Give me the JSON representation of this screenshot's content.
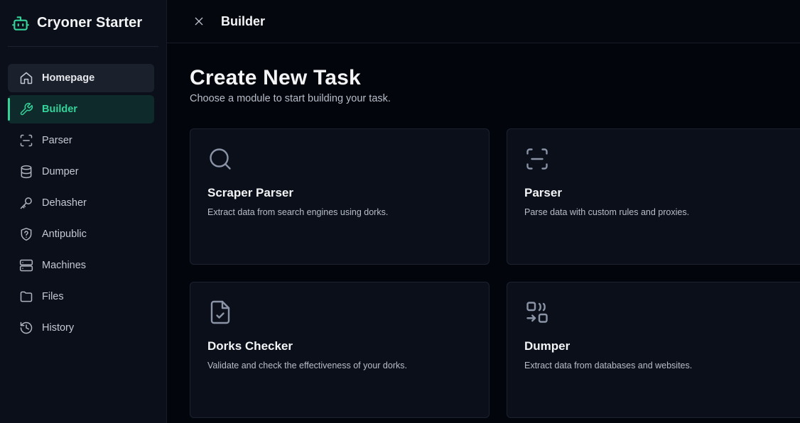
{
  "app": {
    "title": "Cryoner Starter",
    "logo_icon": "robot-icon",
    "accent": "#34d399"
  },
  "sidebar": {
    "items": [
      {
        "label": "Homepage",
        "icon": "home-icon"
      },
      {
        "label": "Builder",
        "icon": "wrench-icon",
        "active": true
      },
      {
        "label": "Parser",
        "icon": "scan-icon"
      },
      {
        "label": "Dumper",
        "icon": "database-icon"
      },
      {
        "label": "Dehasher",
        "icon": "key-icon"
      },
      {
        "label": "Antipublic",
        "icon": "shield-question-icon"
      },
      {
        "label": "Machines",
        "icon": "server-icon"
      },
      {
        "label": "Files",
        "icon": "folder-icon"
      },
      {
        "label": "History",
        "icon": "history-icon"
      }
    ]
  },
  "topbar": {
    "title": "Builder",
    "close_icon": "close-icon"
  },
  "page": {
    "title": "Create New Task",
    "subtitle": "Choose a module to start building your task."
  },
  "modules": [
    {
      "title": "Scraper Parser",
      "description": "Extract data from search engines using dorks.",
      "icon": "search-icon"
    },
    {
      "title": "Parser",
      "description": "Parse data with custom rules and proxies.",
      "icon": "scan-icon"
    },
    {
      "title": "Dorks Checker",
      "description": "Validate and check the effectiveness of your dorks.",
      "icon": "file-check-icon"
    },
    {
      "title": "Dumper",
      "description": "Extract data from databases and websites.",
      "icon": "dumper-icon"
    }
  ]
}
